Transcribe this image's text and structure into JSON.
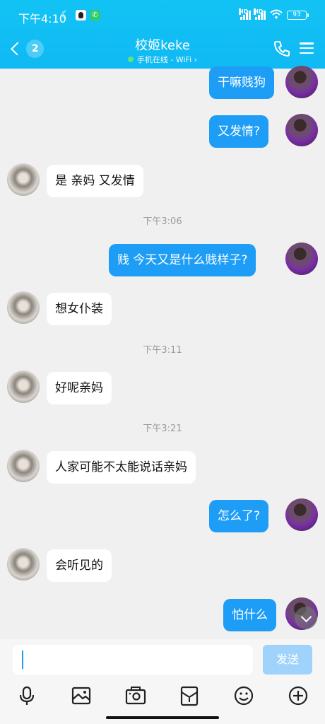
{
  "status_bar": {
    "time": "下午4:10",
    "battery": "93",
    "network_label": "HD"
  },
  "header": {
    "back_count": "2",
    "title": "校姬keke",
    "subtitle": "手机在线 - WiFi"
  },
  "messages": [
    {
      "type": "out",
      "text": "干嘛贱狗"
    },
    {
      "type": "out",
      "text": "又发情?"
    },
    {
      "type": "in",
      "text": "是 亲妈 又发情"
    },
    {
      "type": "time",
      "text": "下午3:06"
    },
    {
      "type": "out",
      "text": "贱 今天又是什么贱样子?"
    },
    {
      "type": "in",
      "text": "想女仆装"
    },
    {
      "type": "time",
      "text": "下午3:11"
    },
    {
      "type": "in",
      "text": "好呢亲妈"
    },
    {
      "type": "time",
      "text": "下午3:21"
    },
    {
      "type": "in",
      "text": "人家可能不太能说话亲妈"
    },
    {
      "type": "out",
      "text": "怎么了?"
    },
    {
      "type": "in",
      "text": "会听见的"
    },
    {
      "type": "out",
      "text": "怕什么"
    }
  ],
  "input": {
    "value": "",
    "send_label": "发送"
  },
  "toolbar": {
    "icons": [
      "microphone-icon",
      "photo-icon",
      "camera-icon",
      "red-packet-icon",
      "emoji-icon",
      "plus-icon"
    ]
  },
  "colors": {
    "header": "#12c3f5",
    "outgoing_bubble": "#1e9df6",
    "send_button": "#9fd3fb"
  }
}
